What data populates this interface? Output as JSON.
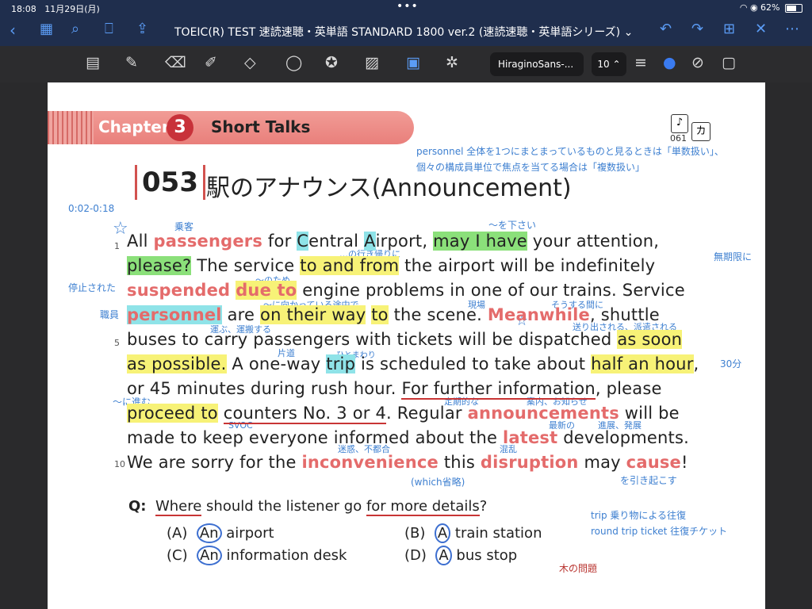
{
  "status": {
    "time": "18:08",
    "date": "11月29日(月)",
    "battery": "62%"
  },
  "nav": {
    "title": "TOEIC(R) TEST 速読速聴・英単語 STANDARD 1800 ver.2 (速読速聴・英単語シリーズ)",
    "chevron": "⌄"
  },
  "toolbar": {
    "font": "HiraginoSans-...",
    "size": "10 ⌃"
  },
  "page": {
    "chapter_word": "Chapter",
    "chapter_num": "3",
    "chapter_title": "Short Talks",
    "audio_num": "061",
    "kana": "カ",
    "item_num": "053",
    "item_title": "駅のアナウンス(Announcement)",
    "line_numbers": [
      "1",
      "5",
      "10"
    ],
    "annotations": {
      "personnel1": "personnel 全体を1つにまとまっているものと見るときは「単数扱い」、",
      "personnel2": "個々の構成員単位で焦点を当てる場合は「複数扱い」",
      "time": "0:02-0:18",
      "passenger": "乗客",
      "kudasai": "〜を下さい",
      "ikikaeri": "…の行き帰りに",
      "mukigen": "無期限に",
      "teishi": "停止された",
      "notame": "〜のため",
      "shokuin": "職員",
      "tochu": "〜に向かっている途中で",
      "genba": "現場",
      "sousuru": "そうする間に",
      "hakobu": "運ぶ、運搬する",
      "okuridasu": "送り出される、派遣される",
      "katamichi": "片道",
      "hitomawari": "ひとまわり",
      "half": "30分",
      "susumu": "〜に進む",
      "teikiteki": "定期的な",
      "annai": "案内、お知らせ",
      "svoc": "SVOC",
      "saishin": "最新の",
      "shinten": "進展、発展",
      "meiwaku": "迷惑、不都合",
      "konran": "混乱",
      "which": "(which省略)",
      "hikiokosu": "を引き起こす",
      "trip1": "trip 乗り物による往復",
      "trip2": "round trip ticket 往復チケット",
      "ki": "木の問題"
    },
    "lines": [
      [
        "All ",
        "passengers",
        " for ",
        "C",
        "entral ",
        "A",
        "irport, ",
        "may I have",
        " your attention,"
      ],
      [
        "please?",
        " The service ",
        "to and from",
        " the airport will be indefinitely"
      ],
      [
        "suspended",
        " ",
        "due to",
        " engine problems in one of our trains. Service"
      ],
      [
        "personnel",
        " are ",
        "on their way",
        " ",
        "to",
        " the scene. ",
        "Meanwhile",
        ", shuttle"
      ],
      [
        "buses to carry passengers with tickets will be dispatched ",
        "as soon"
      ],
      [
        "as possible.",
        " A one-way ",
        "trip",
        " is scheduled to take about ",
        "half an hour",
        ","
      ],
      [
        "or 45 minutes during rush hour. ",
        "For further information",
        ", please"
      ],
      [
        "proceed to",
        " ",
        "counters No. 3 or 4",
        ". Regular ",
        "announcements",
        " will be"
      ],
      [
        "made to keep everyone informed about the ",
        "latest",
        " developments."
      ],
      [
        "We are sorry for the ",
        "inconvenience",
        " this ",
        "disruption",
        " may ",
        "cause",
        "!"
      ]
    ],
    "question": {
      "q_label": "Q:",
      "q_where": "Where",
      "q_mid": " should the listener go ",
      "q_for": "for more details",
      "q_end": "?",
      "options": [
        {
          "label": "(A)",
          "article": "An",
          "text": " airport"
        },
        {
          "label": "(B)",
          "article": "A",
          "text": " train station"
        },
        {
          "label": "(C)",
          "article": "An",
          "text": " information desk"
        },
        {
          "label": "(D)",
          "article": "A",
          "text": " bus stop"
        }
      ]
    }
  }
}
